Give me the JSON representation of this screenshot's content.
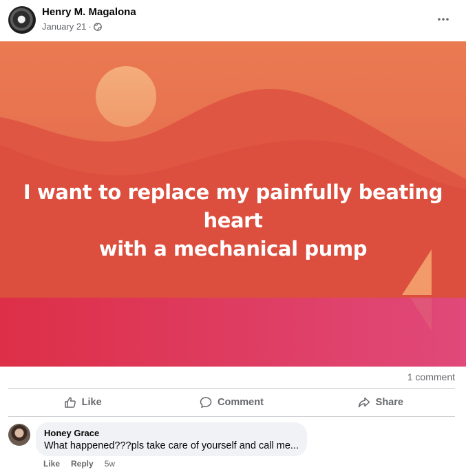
{
  "post": {
    "author": "Henry M. Magalona",
    "date": "January 21",
    "separator": "·",
    "privacy_icon": "globe-icon",
    "more_icon": "more-dots-icon",
    "text_line1": "I want to replace my painfully beating heart",
    "text_line2": "with a mechanical pump"
  },
  "colors": {
    "sky_top": "#e8724c",
    "mountain": "#d94a3d",
    "sun": "#f2a070",
    "sea": "#e03d62",
    "sail": "#f29a6a"
  },
  "stats": {
    "comments": "1 comment"
  },
  "actions": {
    "like": "Like",
    "comment": "Comment",
    "share": "Share"
  },
  "comment": {
    "author": "Honey Grace",
    "text": "What happened???pls take care of yourself and call me...",
    "like": "Like",
    "reply": "Reply",
    "age": "5w"
  }
}
